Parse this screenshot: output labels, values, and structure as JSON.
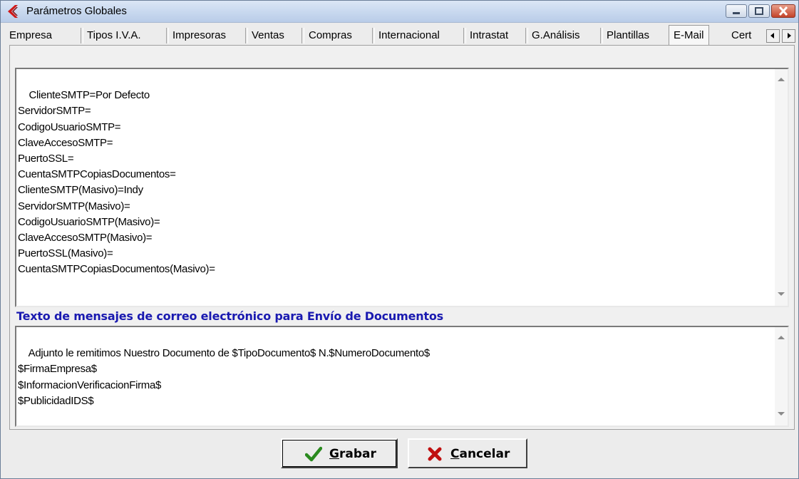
{
  "window": {
    "title": "Parámetros Globales"
  },
  "tabs": [
    {
      "label": "Empresa"
    },
    {
      "label": "Tipos I.V.A."
    },
    {
      "label": "Impresoras"
    },
    {
      "label": "Ventas"
    },
    {
      "label": "Compras"
    },
    {
      "label": "Internacional"
    },
    {
      "label": "Intrastat"
    },
    {
      "label": "G.Análisis"
    },
    {
      "label": "Plantillas"
    },
    {
      "label": "E-Mail",
      "active": true
    },
    {
      "label": "Cert"
    }
  ],
  "smtp_config": {
    "text": "ClienteSMTP=Por Defecto\nServidorSMTP=\nCodigoUsuarioSMTP=\nClaveAccesoSMTP=\nPuertoSSL=\nCuentaSMTPCopiasDocumentos=\nClienteSMTP(Masivo)=Indy\nServidorSMTP(Masivo)=\nCodigoUsuarioSMTP(Masivo)=\nClaveAccesoSMTP(Masivo)=\nPuertoSSL(Masivo)=\nCuentaSMTPCopiasDocumentos(Masivo)="
  },
  "message_section": {
    "label": "Texto de mensajes de correo electrónico para Envío de Documentos",
    "text": "Adjunto le remitimos Nuestro Documento de $TipoDocumento$ N.$NumeroDocumento$\n$FirmaEmpresa$\n$InformacionVerificacionFirma$\n$PublicidadIDS$"
  },
  "buttons": {
    "save": {
      "underlined": "G",
      "rest": "rabar",
      "icon": "check-icon",
      "icon_color": "#2a8a1e"
    },
    "cancel": {
      "underlined": "C",
      "rest": "ancelar",
      "icon": "x-icon",
      "icon_color": "#c01010"
    }
  },
  "colors": {
    "section_label": "#1a1ab0",
    "title_icon": "#d01818"
  }
}
